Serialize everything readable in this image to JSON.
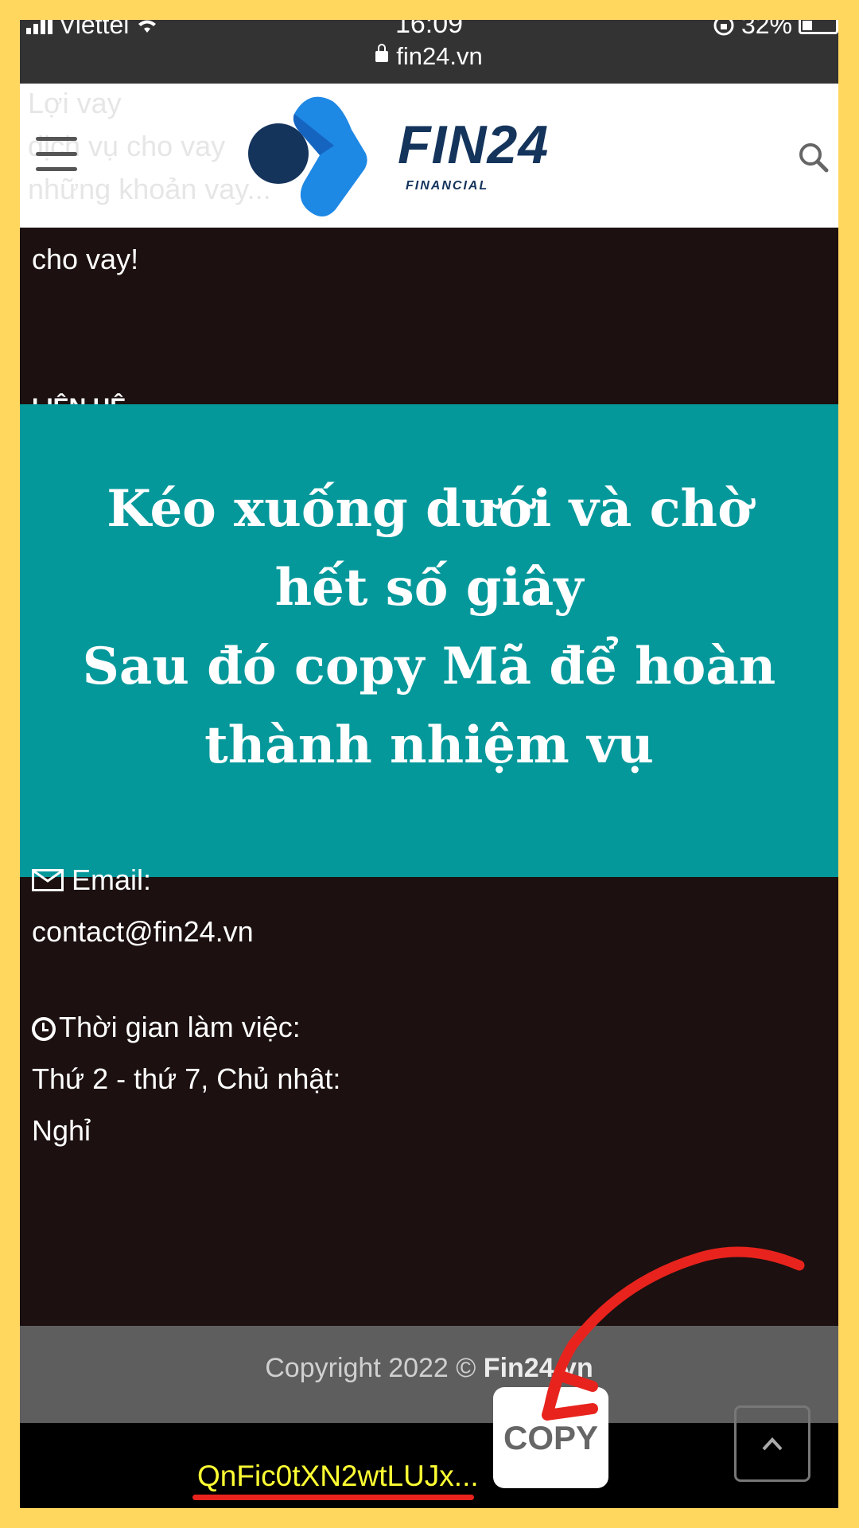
{
  "status": {
    "carrier": "Viettel",
    "time": "16:09",
    "battery": "32%"
  },
  "browser": {
    "url": "fin24.vn"
  },
  "header": {
    "logo_text": "FIN24",
    "logo_sub": "FINANCIAL",
    "ghost_lines": [
      "Lợi vay",
      "dịch vụ cho vay",
      "những khoản vay..."
    ]
  },
  "content": {
    "top_text": "cho vay!",
    "section_heading": "LIÊN HỆ",
    "email_label": "Email:",
    "email": "contact@fin24.vn",
    "hours_label": "Thời gian làm việc:",
    "hours_value": "Thứ 2 - thứ 7, Chủ nhật:",
    "hours_off": "Nghỉ"
  },
  "banner": {
    "text": "Kéo xuống dưới và chờ\nhết số giây\nSau đó copy Mã để hoàn\nthành nhiệm vụ"
  },
  "footer": {
    "copyright_prefix": "Copyright 2022 © ",
    "copyright_brand": "Fin24.vn"
  },
  "bottom": {
    "code": "QnFic0tXN2wtLUJx...",
    "copy_label": "COPY"
  },
  "colors": {
    "page_bg": "#FFD75E",
    "banner": "#05989B",
    "code": "#FFFF33",
    "arrow": "#E8231D",
    "logo_dark": "#14345C",
    "logo_blue": "#1E88E5"
  }
}
